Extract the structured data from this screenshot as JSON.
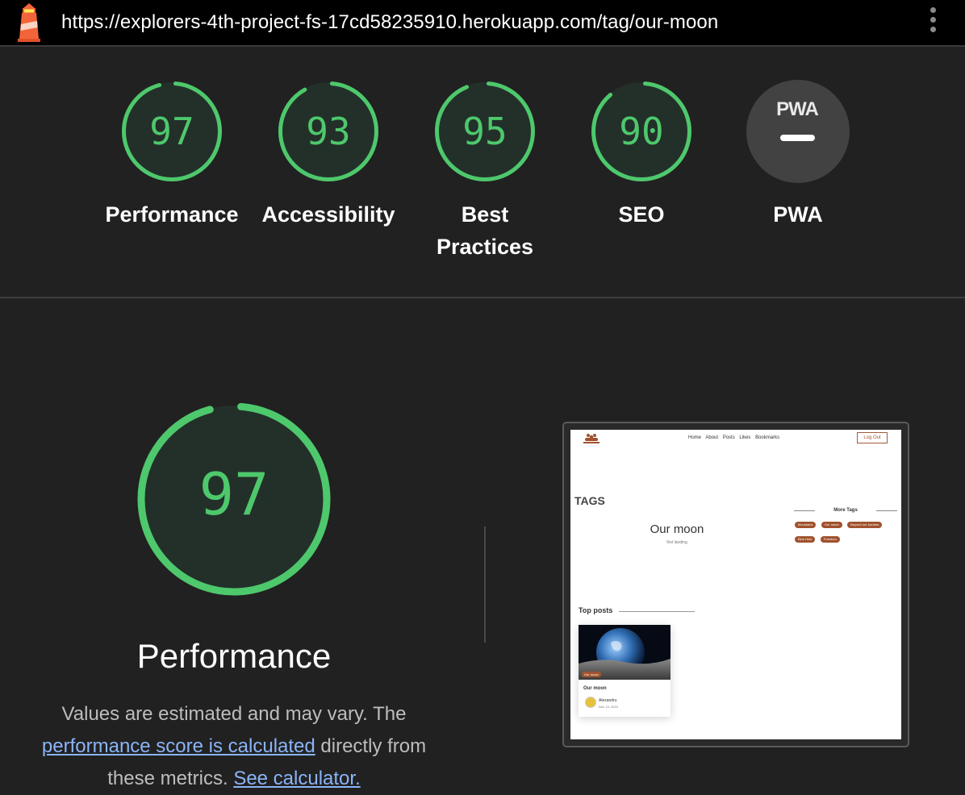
{
  "browser": {
    "url": "https://explorers-4th-project-fs-17cd58235910.herokuapp.com/tag/our-moon",
    "menu_icon": "kebab-menu-icon",
    "logo_icon": "lighthouse-icon"
  },
  "categories": [
    {
      "label": "Performance",
      "score": 97
    },
    {
      "label": "Accessibility",
      "score": 93
    },
    {
      "label": "Best Practices",
      "score": 95
    },
    {
      "label": "SEO",
      "score": 90
    },
    {
      "label": "PWA",
      "badge": "PWA"
    }
  ],
  "performance": {
    "score": 97,
    "title": "Performance",
    "desc_start": "Values are estimated and may vary. The",
    "desc_link": "performance score is calculated",
    "desc_mid": "directly from these metrics.",
    "calc_link": "See calculator."
  },
  "colors": {
    "pass": "#4ec86c",
    "pass_bg": "#23302a",
    "pwa_bg": "#424242"
  },
  "screenshot": {
    "nav": [
      "Home",
      "About",
      "Posts",
      "Likes",
      "Bookmarks"
    ],
    "logout": "Log Out",
    "heading": "TAGS",
    "tag_title": "Our moon",
    "tag_sub": "first landing",
    "more_tags_title": "More Tags",
    "more_tags": [
      "Mountains",
      "Our moon",
      "Beyond our borders",
      "Blue Hole",
      "Freedom"
    ],
    "top_posts": "Top posts",
    "card": {
      "pill": "Our moon",
      "title": "Our moon",
      "author": "Alexandru",
      "date": "Dec 13, 2023"
    }
  }
}
